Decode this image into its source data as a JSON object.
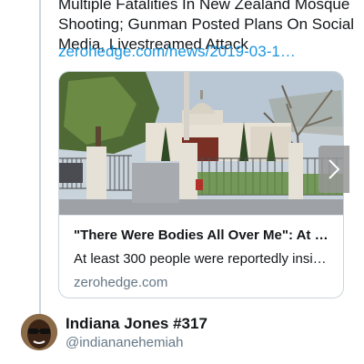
{
  "tweet": {
    "text_lines": [
      "Multiple Fatalities In New Zealand Mosque",
      "Shooting; Gunman Posted Plans On Social",
      "Media, Livestreamed Attack"
    ],
    "link": "zerohedge.com/news/2019-03-1…"
  },
  "card": {
    "title": "\"There Were Bodies All Over Me\": At …",
    "description": "At least 300 people were reportedly insi…",
    "domain": "zerohedge.com"
  },
  "next_user": {
    "name": "Indiana Jones #317",
    "handle": "@indiananehemiah"
  },
  "icons": {
    "next": "chevron-right-icon"
  },
  "colors": {
    "link": "#1b95e0",
    "secondary": "#657786",
    "border": "#ccd6dd"
  }
}
